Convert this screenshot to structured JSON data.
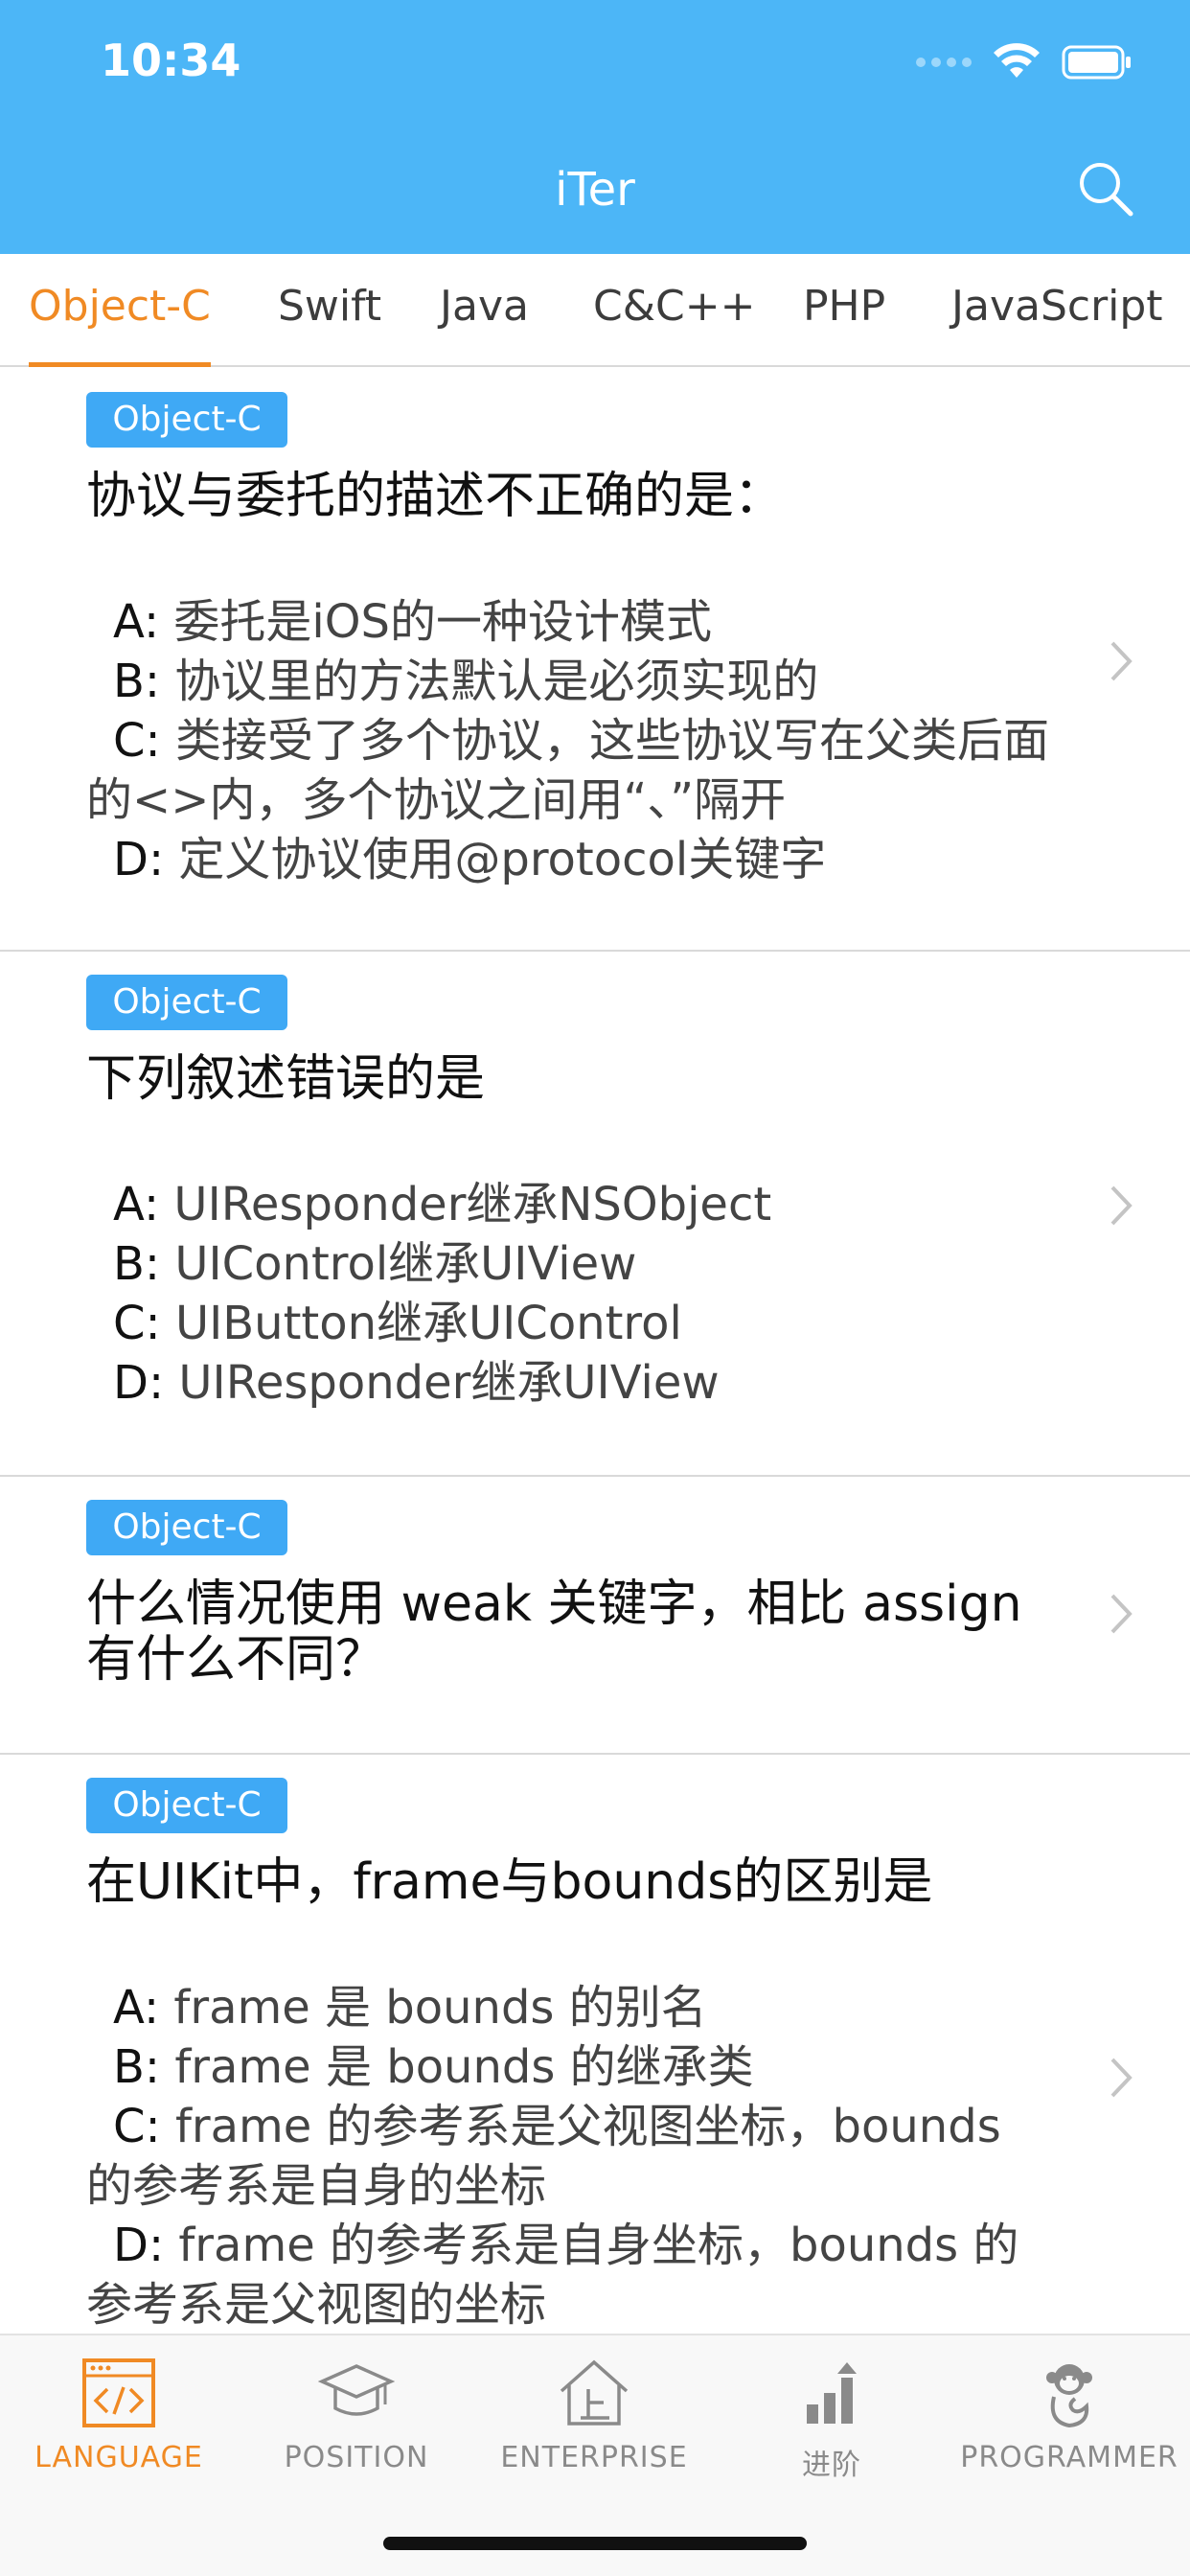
{
  "status_bar": {
    "time": "10:34"
  },
  "nav": {
    "title": "iTer"
  },
  "tabs": [
    {
      "label": "Object-C",
      "active": true
    },
    {
      "label": "Swift"
    },
    {
      "label": "Java"
    },
    {
      "label": "C&C++"
    },
    {
      "label": "PHP"
    },
    {
      "label": "JavaScript"
    }
  ],
  "questions": [
    {
      "tag": "Object-C",
      "title": "协议与委托的描述不正确的是：",
      "options": [
        {
          "letter": "A:",
          "text": " 委托是iOS的一种设计模式"
        },
        {
          "letter": "B:",
          "text": " 协议里的方法默认是必须实现的"
        },
        {
          "letter": "C:",
          "text": " 类接受了多个协议，这些协议写在父类后面的<>内，多个协议之间用“、”隔开"
        },
        {
          "letter": "D:",
          "text": " 定义协议使用@protocol关键字"
        }
      ]
    },
    {
      "tag": "Object-C",
      "title": "下列叙述错误的是",
      "options": [
        {
          "letter": "A:",
          "text": " UIResponder继承NSObject"
        },
        {
          "letter": "B:",
          "text": " UIControl继承UIView"
        },
        {
          "letter": "C:",
          "text": " UIButton继承UIControl"
        },
        {
          "letter": "D:",
          "text": " UIResponder继承UIView"
        }
      ]
    },
    {
      "tag": "Object-C",
      "title": "什么情况使用 weak 关键字，相比 assign 有什么不同？"
    },
    {
      "tag": "Object-C",
      "title": "在UIKit中，frame与bounds的区别是",
      "options": [
        {
          "letter": "A:",
          "text": " frame 是 bounds 的别名"
        },
        {
          "letter": "B:",
          "text": " frame 是 bounds 的继承类"
        },
        {
          "letter": "C:",
          "text": " frame 的参考系是父视图坐标，bounds 的参考系是自身的坐标"
        },
        {
          "letter": "D:",
          "text": " frame 的参考系是自身坐标，bounds 的参考系是父视图的坐标"
        }
      ]
    }
  ],
  "tabbar": [
    {
      "label": "LANGUAGE",
      "icon": "code-window-icon",
      "active": true
    },
    {
      "label": "POSITION",
      "icon": "graduation-cap-icon"
    },
    {
      "label": "ENTERPRISE",
      "icon": "building-icon"
    },
    {
      "label": "进阶",
      "icon": "bar-chart-icon"
    },
    {
      "label": "PROGRAMMER",
      "icon": "monkey-icon"
    }
  ],
  "colors": {
    "header": "#4cb6f7",
    "accent": "#f08a24",
    "badge": "#3fa9f5"
  }
}
